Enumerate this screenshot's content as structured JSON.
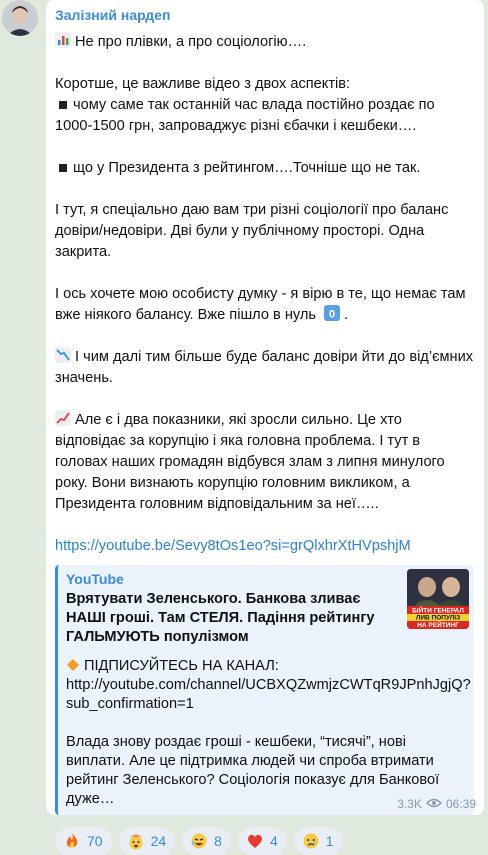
{
  "post": {
    "channel_name": "Залізний нардеп",
    "line1": "Не про плівки, а про соціологію….",
    "line2": "Коротше, це важливе відео з двох аспектів:",
    "bullet1": "чому саме так останній час влада постійно роздає по 1000-1500 грн, запроваджує різні єбачки і кешбеки….",
    "bullet2": "що у Президента з рейтингом….Точніше що не так.",
    "para3": "І тут, я спеціально даю вам три різні соціології про баланс довіри/недовіри. Дві були у публічному просторі. Одна закрита.",
    "para4": "І ось хочете мою особисту думку - я вірю в те, що немає там вже ніякого балансу. Вже пішло в нуль",
    "para5": "І чим далі тим більше буде баланс довіри йти до від’ємних значень.",
    "para6": "Але є і два показники, які зросли сильно. Це хто відповідає за корупцію і яка головна проблема. І тут в головах наших громадян відбувся злам з липня минулого року. Вони визнають корупцію головним викликом, а Президента головним відповідальним за неї…..",
    "link": "https://youtube.be/Sevy8tOs1eo?si=grQlxhrXtHVpshjM"
  },
  "preview": {
    "site": "YouTube",
    "title": "Врятувати Зеленського. Банкова зливає НАШІ гроші. Там СТЕЛЯ. Падіння рейтингу ГАЛЬМУЮТЬ популізмом",
    "subscribe": "ПІДПИСУЙТЕСЬ НА КАНАЛ:",
    "channel_url": "http://youtube.com/channel/UCBXQZwmjzCWTqR9JPnhJgjQ?sub_confirmation=1",
    "desc": "Влада знову роздає гроші - кешбеки, “тисячі”, нові виплати. Але це підтримка людей чи спроба втримати рейтинг Зеленського? Соціологія показує для Банкової дуже…",
    "thumb_text_1": "БІЙТИ ГЕНЕРАЛ",
    "thumb_text_2": "ЛИВ ПОПУЛІЗ",
    "thumb_text_3": "НА РЕЙТИНГ"
  },
  "reactions": [
    {
      "icon": "fire-icon",
      "count": "70"
    },
    {
      "icon": "exploding-head-icon",
      "count": "24"
    },
    {
      "icon": "rofl-icon",
      "count": "8"
    },
    {
      "icon": "heart-icon",
      "count": "4"
    },
    {
      "icon": "crying-face-icon",
      "count": "1"
    }
  ],
  "meta": {
    "views": "3.3K",
    "time": "06:39"
  },
  "colors": {
    "background": "#dfe9dc",
    "accent": "#3a8cd6",
    "preview_bg": "#eaf2fb"
  }
}
